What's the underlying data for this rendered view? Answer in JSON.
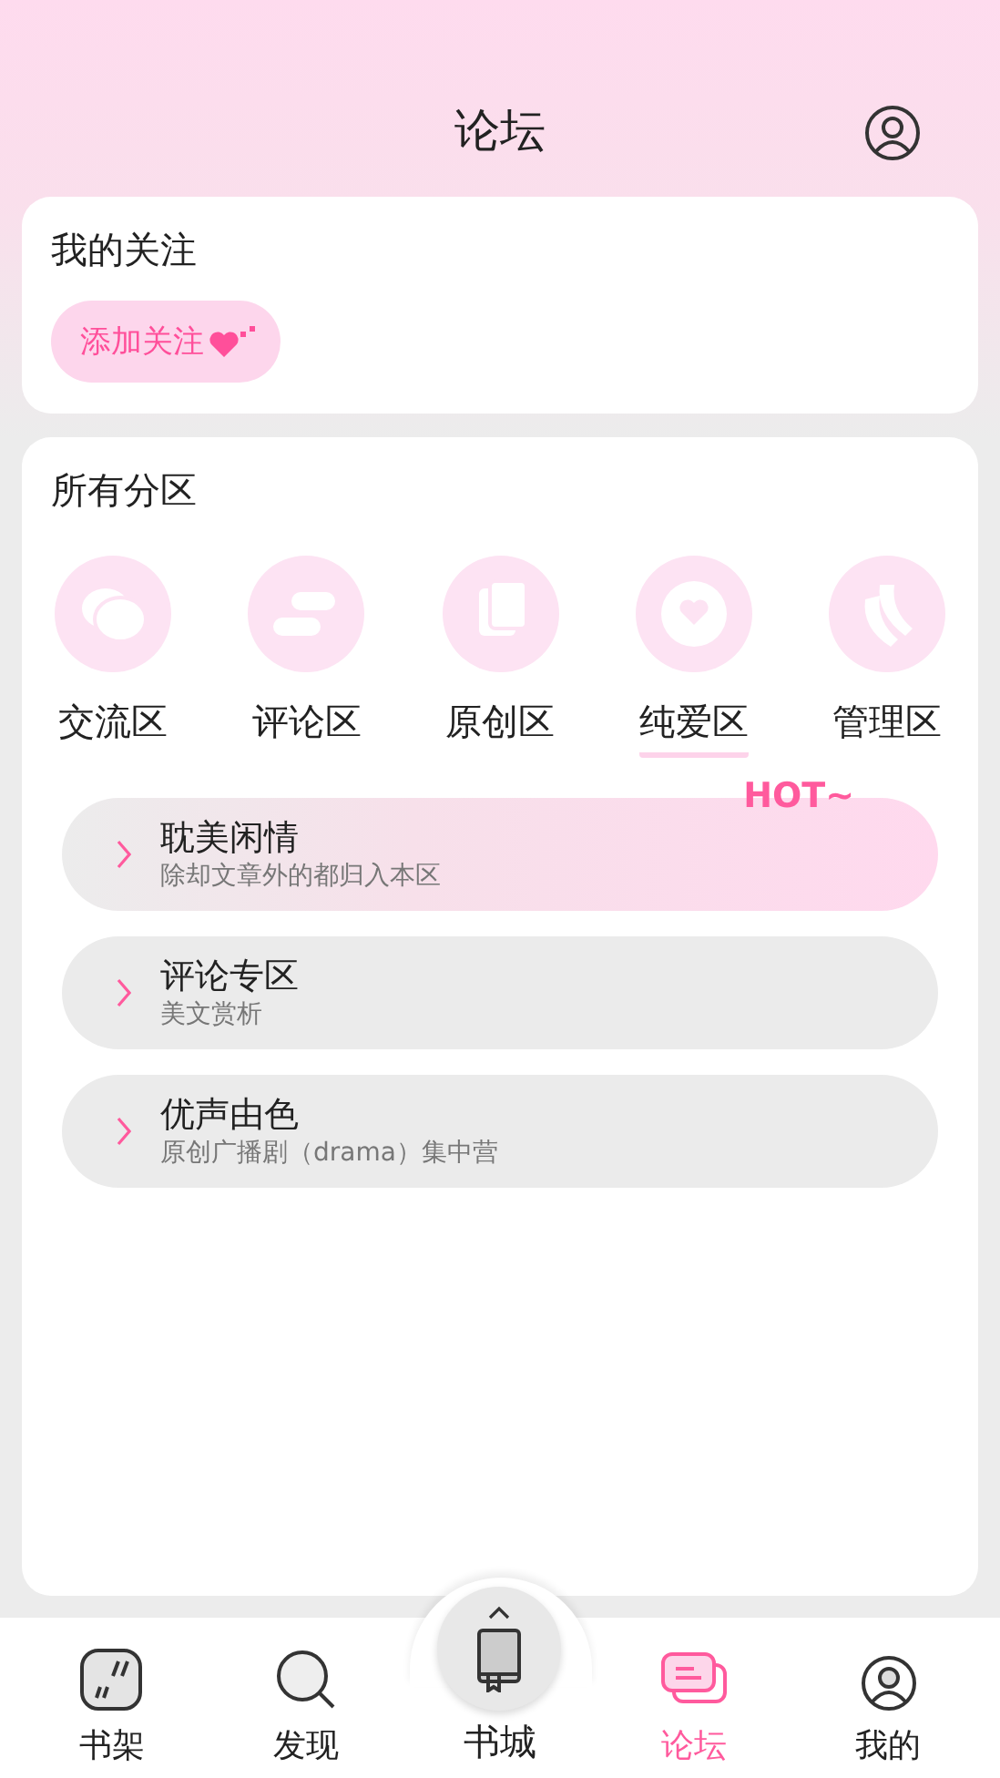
{
  "header": {
    "title": "论坛"
  },
  "following": {
    "title": "我的关注",
    "button": "添加关注"
  },
  "sections": {
    "title": "所有分区",
    "categories": [
      {
        "label": "交流区",
        "underlined": false
      },
      {
        "label": "评论区",
        "underlined": false
      },
      {
        "label": "原创区",
        "underlined": false
      },
      {
        "label": "纯爱区",
        "underlined": true
      },
      {
        "label": "管理区",
        "underlined": false
      }
    ]
  },
  "boards": [
    {
      "title": "耽美闲情",
      "subtitle": "除却文章外的都归入本区",
      "highlighted": true,
      "badge": "HOT~"
    },
    {
      "title": "评论专区",
      "subtitle": "美文赏析",
      "highlighted": false
    },
    {
      "title": "优声由色",
      "subtitle": "原创广播剧（drama）集中营",
      "highlighted": false
    }
  ],
  "nav": [
    {
      "label": "书架",
      "kind": "tab",
      "selected": false
    },
    {
      "label": "发现",
      "kind": "tab",
      "selected": false
    },
    {
      "label": "书城",
      "kind": "center",
      "selected": false
    },
    {
      "label": "论坛",
      "kind": "tab",
      "selected": true
    },
    {
      "label": "我的",
      "kind": "tab",
      "selected": false
    }
  ]
}
